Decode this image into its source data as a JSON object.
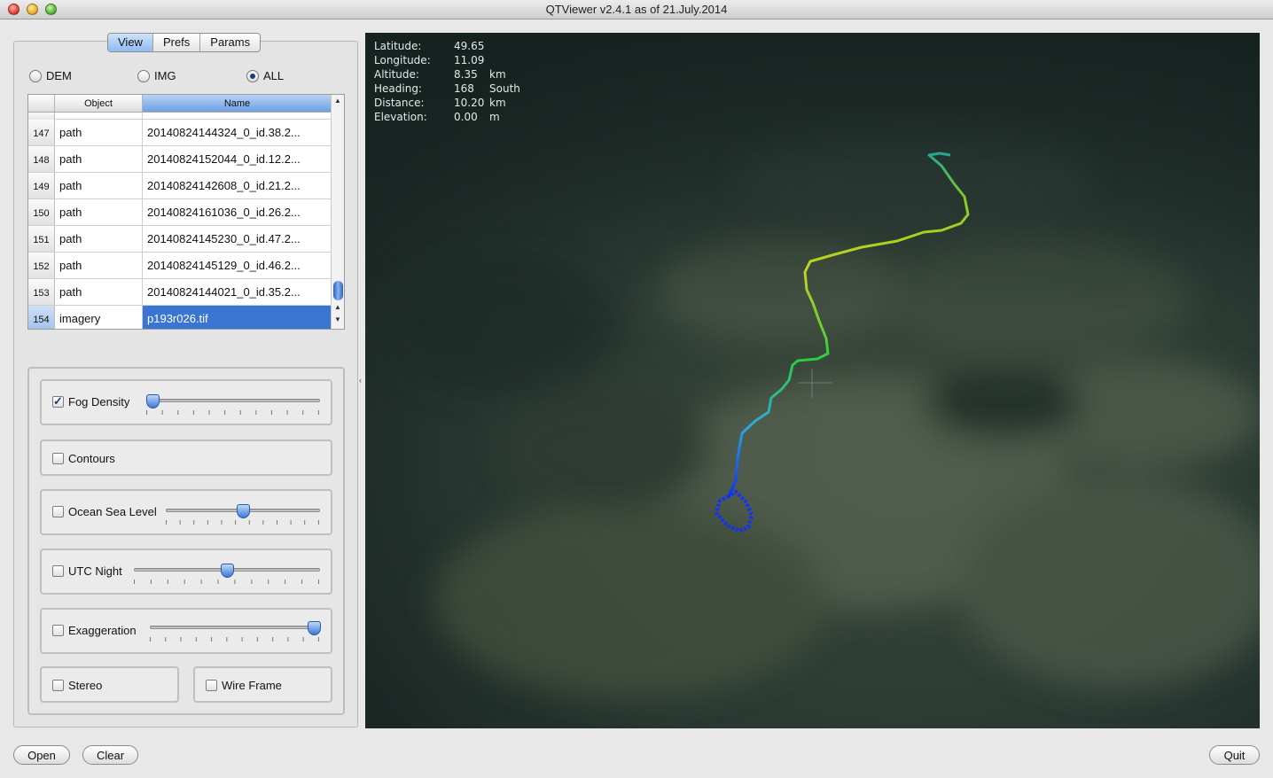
{
  "window": {
    "title": "QTViewer v2.4.1 as of 21.July.2014"
  },
  "tabs": [
    {
      "label": "View",
      "active": true
    },
    {
      "label": "Prefs",
      "active": false
    },
    {
      "label": "Params",
      "active": false
    }
  ],
  "filter": {
    "options": [
      "DEM",
      "IMG",
      "ALL"
    ],
    "selected": "ALL"
  },
  "table": {
    "columns": [
      "Object",
      "Name"
    ],
    "rows": [
      {
        "num": "147",
        "object": "path",
        "name": "20140824144324_0_id.38.2..."
      },
      {
        "num": "148",
        "object": "path",
        "name": "20140824152044_0_id.12.2..."
      },
      {
        "num": "149",
        "object": "path",
        "name": "20140824142608_0_id.21.2..."
      },
      {
        "num": "150",
        "object": "path",
        "name": "20140824161036_0_id.26.2..."
      },
      {
        "num": "151",
        "object": "path",
        "name": "20140824145230_0_id.47.2..."
      },
      {
        "num": "152",
        "object": "path",
        "name": "20140824145129_0_id.46.2..."
      },
      {
        "num": "153",
        "object": "path",
        "name": "20140824144021_0_id.35.2..."
      },
      {
        "num": "154",
        "object": "imagery",
        "name": "p193r026.tif",
        "selected": true
      }
    ]
  },
  "controls": {
    "fog_density": {
      "label": "Fog Density",
      "checked": true,
      "value": 0.0
    },
    "contours": {
      "label": "Contours",
      "checked": false
    },
    "ocean_sea_level": {
      "label": "Ocean Sea Level",
      "checked": false,
      "value": 0.5
    },
    "utc_night": {
      "label": "UTC Night",
      "checked": false,
      "value": 0.5
    },
    "exaggeration": {
      "label": "Exaggeration",
      "checked": false,
      "value": 1.0
    },
    "stereo": {
      "label": "Stereo",
      "checked": false
    },
    "wire_frame": {
      "label": "Wire Frame",
      "checked": false
    }
  },
  "hud": {
    "latitude": {
      "label": "Latitude:",
      "value": "49.65",
      "unit": ""
    },
    "longitude": {
      "label": "Longitude:",
      "value": "11.09",
      "unit": ""
    },
    "altitude": {
      "label": "Altitude:",
      "value": "8.35",
      "unit": "km"
    },
    "heading": {
      "label": "Heading:",
      "value": "168",
      "unit": "South"
    },
    "distance": {
      "label": "Distance:",
      "value": "10.20",
      "unit": "km"
    },
    "elevation": {
      "label": "Elevation:",
      "value": "0.00",
      "unit": "m"
    }
  },
  "buttons": {
    "open": "Open",
    "clear": "Clear",
    "quit": "Quit"
  },
  "colors": {
    "selection": "#3b75d4",
    "track_start": "#0033ff",
    "track_mid": "#33cc33",
    "track_end": "#cccc00"
  }
}
